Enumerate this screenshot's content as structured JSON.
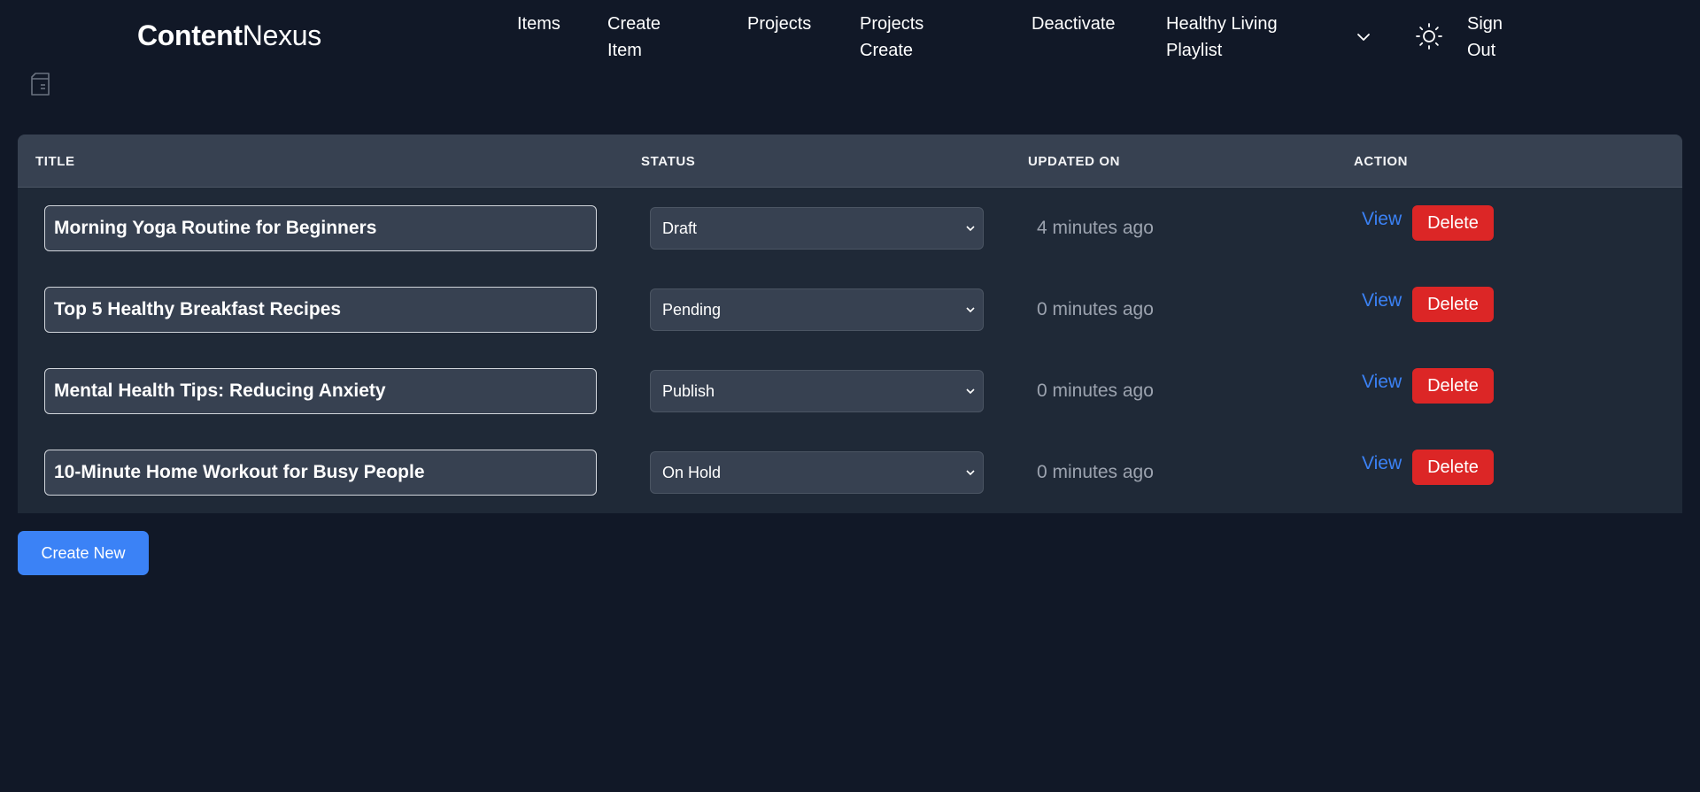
{
  "brand": {
    "part1": "Content",
    "part2": "Nexus"
  },
  "nav": {
    "items": "Items",
    "create_item_l1": "Create",
    "create_item_l2": "Item",
    "projects": "Projects",
    "projects_create_l1": "Projects",
    "projects_create_l2": "Create",
    "deactivate": "Deactivate",
    "playlist_l1": "Healthy Living",
    "playlist_l2": "Playlist",
    "signout_l1": "Sign",
    "signout_l2": "Out"
  },
  "icons": {
    "sidebar": "sidebar-toggle-icon",
    "theme": "sun-icon",
    "dropdown": "chevron-down-icon"
  },
  "table": {
    "headers": {
      "title": "TITLE",
      "status": "STATUS",
      "updated": "UPDATED ON",
      "action": "ACTION"
    },
    "rows": [
      {
        "title": "Morning Yoga Routine for Beginners",
        "status": "Draft",
        "updated": "4 minutes ago",
        "view": "View",
        "delete": "Delete"
      },
      {
        "title": "Top 5 Healthy Breakfast Recipes",
        "status": "Pending",
        "updated": "0 minutes ago",
        "view": "View",
        "delete": "Delete"
      },
      {
        "title": "Mental Health Tips: Reducing Anxiety",
        "status": "Publish",
        "updated": "0 minutes ago",
        "view": "View",
        "delete": "Delete"
      },
      {
        "title": "10-Minute Home Workout for Busy People",
        "status": "On Hold",
        "updated": "0 minutes ago",
        "view": "View",
        "delete": "Delete"
      }
    ]
  },
  "create_button": "Create New",
  "colors": {
    "background": "#111827",
    "table_body": "#1f2937",
    "table_header": "#374151",
    "link": "#3b82f6",
    "danger": "#dc2626",
    "primary": "#3b82f6"
  }
}
